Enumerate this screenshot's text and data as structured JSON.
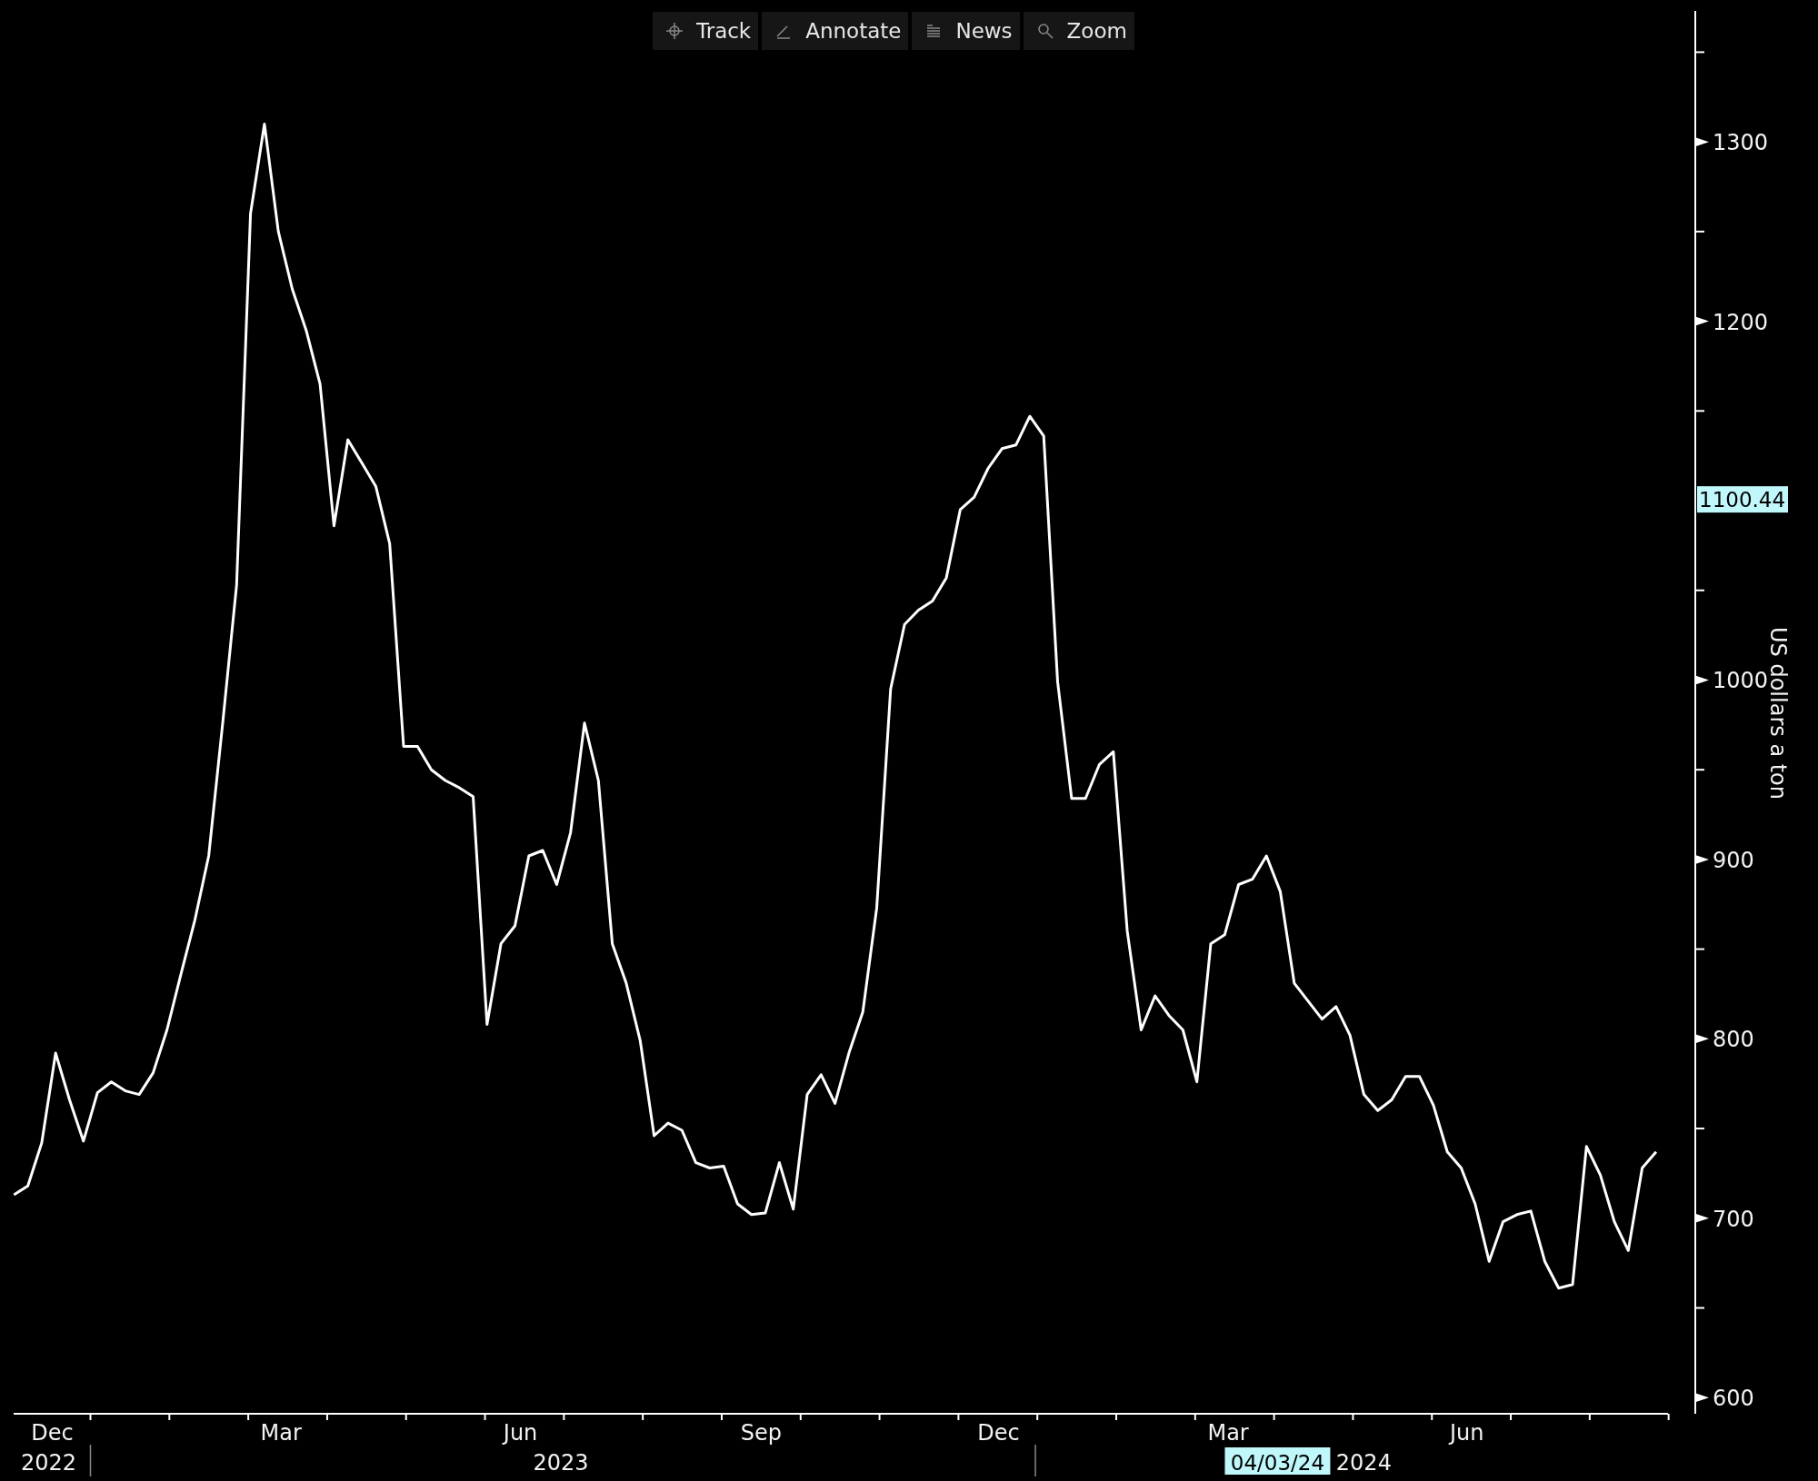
{
  "toolbar": {
    "buttons": [
      {
        "kind": "track",
        "label": "Track"
      },
      {
        "kind": "annotate",
        "label": "Annotate"
      },
      {
        "kind": "news",
        "label": "News"
      },
      {
        "kind": "zoom",
        "label": "Zoom"
      }
    ]
  },
  "chart": {
    "chart_data": {
      "type": "line",
      "ylabel": "US dollars a ton",
      "ylim": [
        591,
        1373
      ],
      "yticks": [
        600,
        700,
        800,
        900,
        1000,
        1200,
        1300
      ],
      "series": [
        {
          "color": "#ffffff",
          "values": [
            713,
            718,
            742,
            792,
            766,
            743,
            770,
            776,
            771,
            769,
            781,
            805,
            836,
            866,
            902,
            976,
            1053,
            1260,
            1310,
            1250,
            1218,
            1195,
            1165,
            1086,
            1134,
            1121,
            1108,
            1076,
            963,
            963,
            950,
            944,
            940,
            935,
            808,
            853,
            863,
            902,
            905,
            886,
            915,
            976,
            944,
            853,
            831,
            799,
            746,
            753,
            749,
            731,
            728,
            729,
            708,
            702,
            703,
            731,
            705,
            769,
            780,
            764,
            792,
            815,
            873,
            995,
            1031,
            1039,
            1044,
            1057,
            1095,
            1102,
            1118,
            1129,
            1131,
            1147,
            1136,
            999,
            934,
            934,
            953,
            960,
            860,
            805,
            824,
            813,
            805,
            776,
            853,
            858,
            886,
            889,
            902,
            882,
            831,
            821,
            811,
            818,
            802,
            769,
            760,
            766,
            779,
            779,
            763,
            737,
            728,
            708,
            676,
            698,
            702,
            704,
            676,
            661,
            663,
            740,
            724,
            698,
            682,
            728,
            737
          ]
        }
      ]
    },
    "month_labels": [
      "Dec",
      "Mar",
      "Jun",
      "Sep",
      "Dec",
      "Mar",
      "Jun"
    ],
    "year_labels": [
      "2022",
      "2023",
      "2024"
    ],
    "crosshair": {
      "date": "04/03/24",
      "value": "1100.44"
    }
  }
}
